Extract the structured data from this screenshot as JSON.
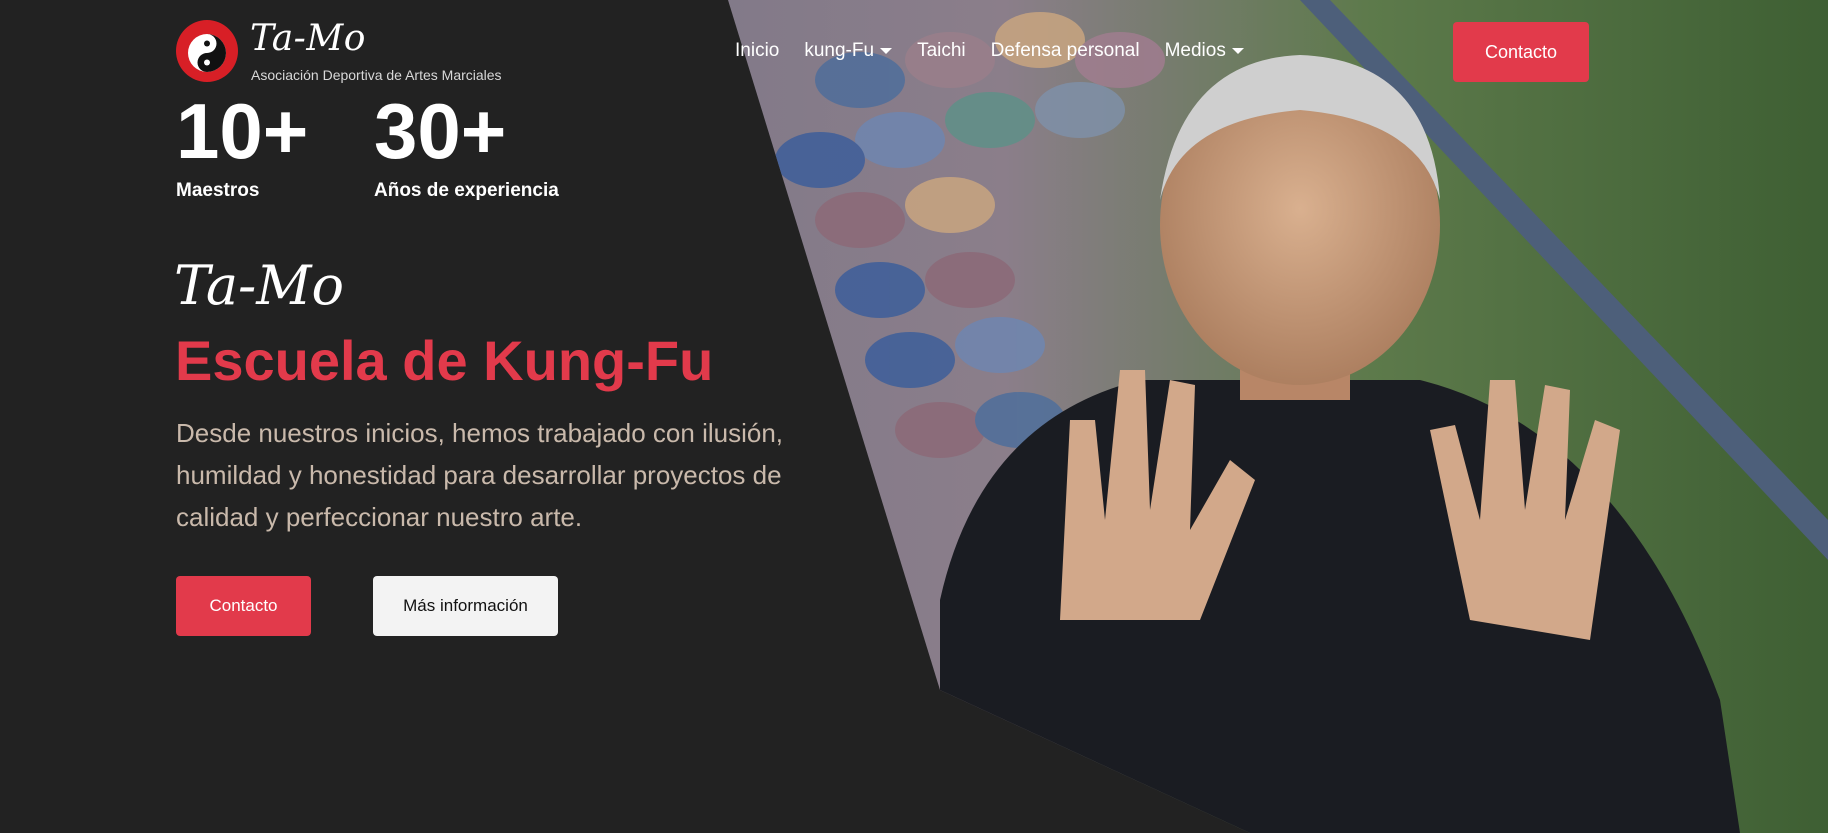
{
  "header": {
    "brand_name": "Ta-Mo",
    "brand_subtitle": "Asociación Deportiva de Artes Marciales",
    "logo_icon": "yin-yang-logo-icon",
    "contact_button": "Contacto"
  },
  "nav": {
    "items": [
      {
        "label": "Inicio",
        "dropdown": false
      },
      {
        "label": "kung-Fu",
        "dropdown": true
      },
      {
        "label": "Taichi",
        "dropdown": false
      },
      {
        "label": "Defensa personal",
        "dropdown": false
      },
      {
        "label": "Medios",
        "dropdown": true
      }
    ]
  },
  "stats": [
    {
      "value": "10+",
      "label": "Maestros"
    },
    {
      "value": "30+",
      "label": "Años de experiencia"
    }
  ],
  "hero": {
    "brand_script": "Ta-Mo",
    "title": "Escuela de Kung-Fu",
    "description": "Desde nuestros inicios, hemos trabajado con ilusión, humildad y honestidad para desarrollar proyectos de calidad y perfeccionar nuestro arte.",
    "primary_button": "Contacto",
    "secondary_button": "Más información"
  },
  "colors": {
    "accent": "#e23a4b",
    "background": "#222222",
    "description_text": "#c9b9ab"
  }
}
